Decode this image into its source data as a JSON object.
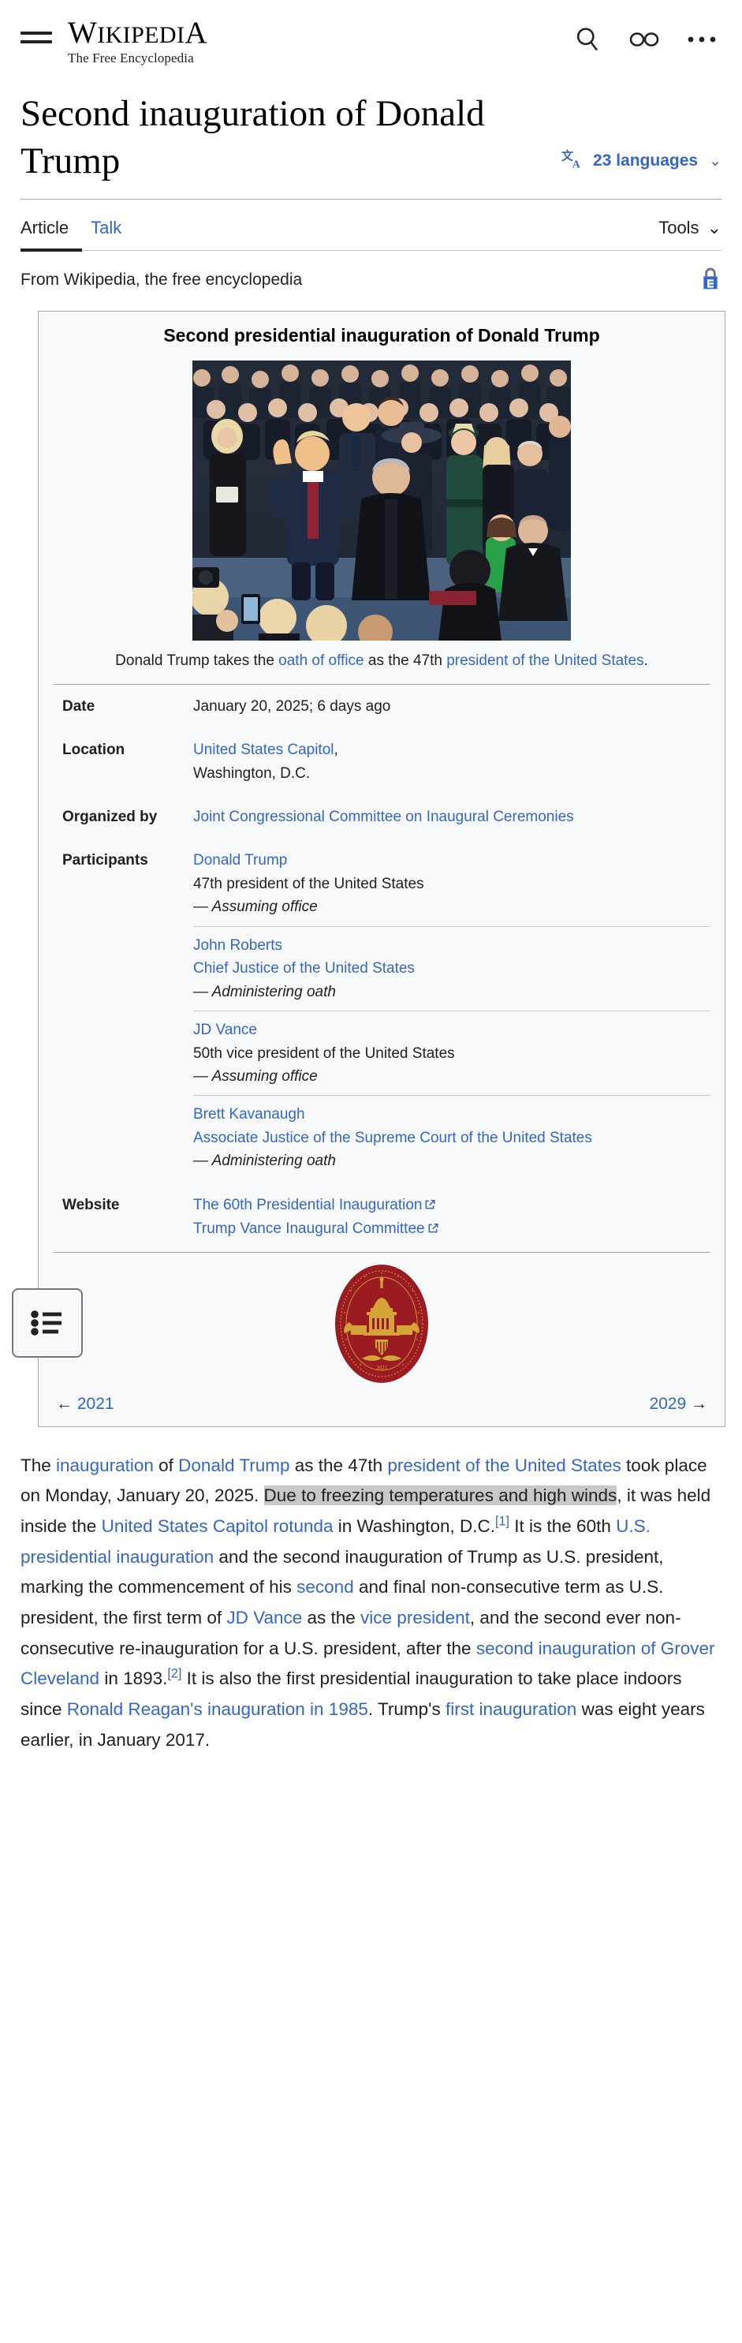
{
  "header": {
    "menu_icon": "hamburger-menu-icon",
    "wordmark_main": "WIKIPEDIA",
    "wordmark_tagline": "The Free Encyclopedia",
    "search_icon": "search-icon",
    "appearance_icon": "glasses-appearance-icon",
    "more_icon": "ellipsis-more-icon"
  },
  "title": {
    "text": "Second inauguration of Donald Trump",
    "language_icon": "language-translate-icon",
    "language_label": "23 languages",
    "language_chevron": "⌄"
  },
  "tabs": {
    "article": "Article",
    "talk": "Talk",
    "tools": "Tools",
    "tools_chevron": "⌄"
  },
  "site_sub": {
    "text": "From Wikipedia, the free encyclopedia",
    "protection_icon": "padlock-protected-icon"
  },
  "toc": {
    "icon": "bulleted-list-toc-icon"
  },
  "infobox": {
    "title": "Second presidential inauguration of Donald Trump",
    "image_alt": "Donald Trump taking the oath of office inside the Capitol rotunda",
    "caption": {
      "pre": "Donald Trump takes the ",
      "link1": "oath of office",
      "mid": " as the 47th ",
      "link2": "president of the United States",
      "post": "."
    },
    "rows": [
      {
        "label": "Date",
        "lines": [
          {
            "type": "plain",
            "text": "January 20, 2025; 6 days ago"
          }
        ]
      },
      {
        "label": "Location",
        "lines": [
          {
            "type": "link_comma",
            "text": "United States Capitol",
            "suffix": ","
          },
          {
            "type": "plain",
            "text": "Washington, D.C."
          }
        ]
      },
      {
        "label": "Organized by",
        "lines": [
          {
            "type": "link",
            "text": "Joint Congressional Committee on Inaugural Ceremonies"
          }
        ]
      },
      {
        "label": "Participants",
        "participants": [
          {
            "name": "Donald Trump",
            "role": "47th president of the United States",
            "role_is_link": false,
            "note": "— Assuming office"
          },
          {
            "name": "John Roberts",
            "role": "Chief Justice of the United States",
            "role_is_link": true,
            "note": "— Administering oath"
          },
          {
            "name": "JD Vance",
            "role": "50th vice president of the United States",
            "role_is_link": false,
            "note": "— Assuming office"
          },
          {
            "name": "Brett Kavanaugh",
            "role": "Associate Justice of the Supreme Court of the United States",
            "role_is_link": true,
            "note": "— Administering oath"
          }
        ]
      },
      {
        "label": "Website",
        "lines": [
          {
            "type": "ext_link",
            "text": "The 60th Presidential Inauguration"
          },
          {
            "type": "ext_link",
            "text": "Trump Vance Inaugural Committee"
          }
        ]
      }
    ],
    "seal": {
      "icon": "presidential-inauguration-seal",
      "ring_text_top": "INAUGURATION OF THE",
      "ring_text_bottom": "PRESIDENT AND VICE PRESIDENT",
      "year": "2025",
      "color_primary": "#9b1b23",
      "color_accent": "#d4a437"
    },
    "nav": {
      "prev_arrow": "←",
      "prev_label": "2021",
      "next_label": "2029",
      "next_arrow": "→"
    }
  },
  "body": {
    "paragraph_parts": [
      {
        "t": "The ",
        "k": "p"
      },
      {
        "t": "inauguration",
        "k": "a"
      },
      {
        "t": " of ",
        "k": "p"
      },
      {
        "t": "Donald Trump",
        "k": "a"
      },
      {
        "t": " as the 47th ",
        "k": "p"
      },
      {
        "t": "president of the United States",
        "k": "a"
      },
      {
        "t": " took place on Monday, January 20, 2025. ",
        "k": "p"
      },
      {
        "t": "Due to freezing temperatures and high winds",
        "k": "h"
      },
      {
        "t": ", it was held inside the ",
        "k": "p"
      },
      {
        "t": "United States Capitol rotunda",
        "k": "a"
      },
      {
        "t": " in Washington, D.C.",
        "k": "p"
      },
      {
        "t": "[1]",
        "k": "s"
      },
      {
        "t": " It is the 60th ",
        "k": "p"
      },
      {
        "t": "U.S. presidential inauguration",
        "k": "a"
      },
      {
        "t": " and the second inauguration of Trump as U.S. president, marking the commencement of his ",
        "k": "p"
      },
      {
        "t": "second",
        "k": "a"
      },
      {
        "t": " and final non-consecutive term as U.S. president, the first term of ",
        "k": "p"
      },
      {
        "t": "JD Vance",
        "k": "a"
      },
      {
        "t": " as the ",
        "k": "p"
      },
      {
        "t": "vice president",
        "k": "a"
      },
      {
        "t": ", and the second ever non-consecutive re-inauguration for a U.S. president, after the ",
        "k": "p"
      },
      {
        "t": "second inauguration of Grover Cleveland",
        "k": "a"
      },
      {
        "t": " in 1893.",
        "k": "p"
      },
      {
        "t": "[2]",
        "k": "s"
      },
      {
        "t": " It is also the first presidential inauguration to take place indoors since ",
        "k": "p"
      },
      {
        "t": "Ronald Reagan's inauguration in 1985",
        "k": "a"
      },
      {
        "t": ". Trump's ",
        "k": "p"
      },
      {
        "t": "first inauguration",
        "k": "a"
      },
      {
        "t": " was eight years earlier, in January 2017.",
        "k": "p"
      }
    ]
  }
}
